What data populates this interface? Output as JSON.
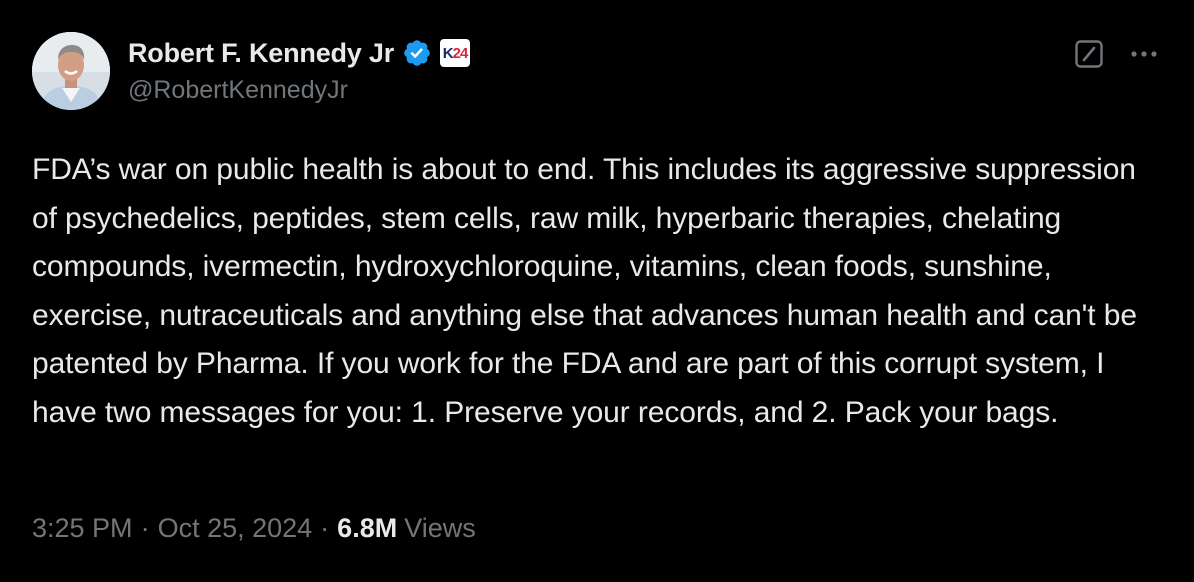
{
  "author": {
    "display_name": "Robert F. Kennedy Jr",
    "handle": "@RobertKennedyJr",
    "verified": true,
    "verified_color": "#1d9bf0",
    "affiliation_badge_icon": "k24-campaign-badge-icon",
    "affiliation_badge_text": {
      "letter": "K",
      "number": "24"
    }
  },
  "actions": {
    "grok_icon": "grok-slash-icon",
    "more_icon": "more-dots-icon"
  },
  "tweet": {
    "text": "FDA’s war on public health is about to end. This includes its aggressive suppression of psychedelics, peptides, stem cells, raw milk, hyperbaric therapies, chelating compounds, ivermectin, hydroxychloroquine, vitamins, clean foods, sunshine, exercise, nutraceuticals and anything else that advances human health and can't be patented by Pharma. If you work for the FDA and are part of this corrupt system, I have two messages for you: 1. Preserve your records, and 2. Pack your bags."
  },
  "meta": {
    "time": "3:25 PM",
    "separator": "·",
    "date": "Oct 25, 2024",
    "views_count": "6.8M",
    "views_label": "Views"
  },
  "colors": {
    "background": "#000000",
    "primary_text": "#e7e9ea",
    "secondary_text": "#71767b"
  }
}
